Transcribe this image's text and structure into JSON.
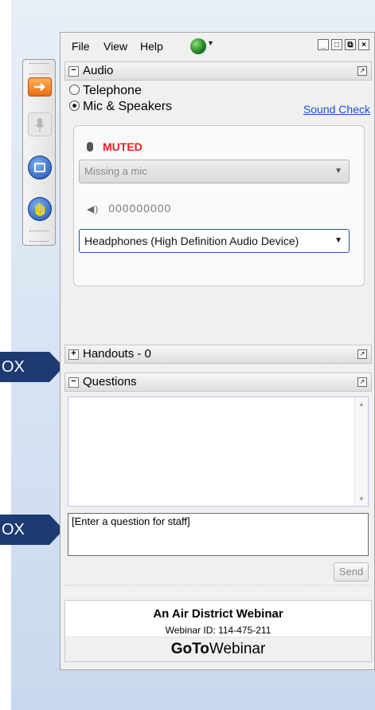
{
  "callouts": {
    "upper": "OX",
    "lower": "OX"
  },
  "menu": {
    "file": "File",
    "view": "View",
    "help": "Help"
  },
  "audio": {
    "header": "Audio",
    "options": [
      "Telephone",
      "Mic & Speakers"
    ],
    "selected": "Mic & Speakers",
    "sound_check": "Sound Check",
    "muted": "MUTED",
    "mic_select": "Missing a mic",
    "speaker_level": "000000000",
    "speaker_select": "Headphones (High Definition Audio Device)"
  },
  "handouts": {
    "header": "Handouts - 0"
  },
  "questions": {
    "header": "Questions",
    "input_value": "[Enter a question for staff]",
    "send": "Send"
  },
  "webinar": {
    "title": "An Air District Webinar",
    "id_line": "Webinar ID: 114-475-211",
    "brand_bold": "GoTo",
    "brand_light": "Webinar"
  },
  "colors": {
    "muted": "#e32020",
    "link": "#1a4fd0",
    "callout": "#1d3a72"
  }
}
